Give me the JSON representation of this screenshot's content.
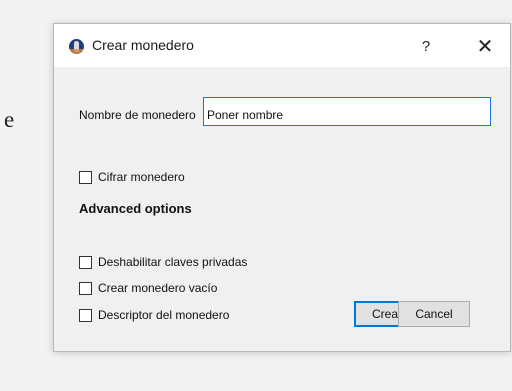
{
  "background": {
    "partial_text": "e"
  },
  "dialog": {
    "title": "Crear monedero",
    "app_icon": "bitcoin-core-icon",
    "help_label": "?",
    "close_label": "✕",
    "wallet_name": {
      "label": "Nombre de monedero",
      "value": "Poner nombre"
    },
    "encrypt_wallet": {
      "label": "Cifrar monedero",
      "checked": false
    },
    "advanced": {
      "title": "Advanced options",
      "options": [
        {
          "label": "Deshabilitar claves privadas",
          "checked": false
        },
        {
          "label": "Crear monedero vacío",
          "checked": false
        },
        {
          "label": "Descriptor del monedero",
          "checked": false
        }
      ]
    },
    "buttons": {
      "create": "Crear",
      "cancel": "Cancel"
    },
    "colors": {
      "accent": "#0078d7",
      "icon_blue": "#1f3f78",
      "icon_orange": "#d88a3d"
    }
  }
}
